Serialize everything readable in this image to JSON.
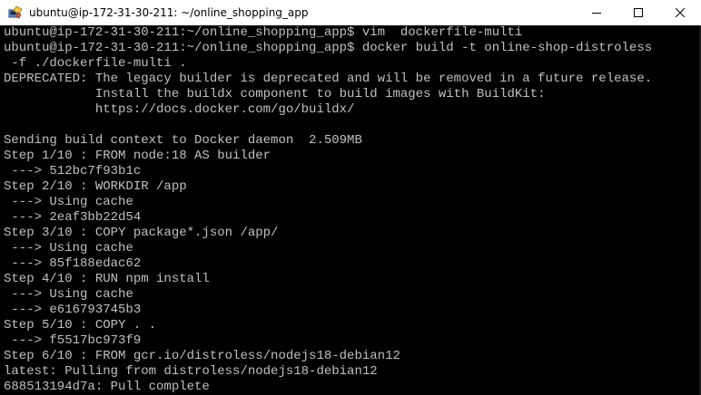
{
  "window": {
    "title": "ubuntu@ip-172-31-30-211: ~/online_shopping_app",
    "icon": "putty-icon",
    "controls": [
      "minimize-icon",
      "maximize-icon",
      "close-icon"
    ]
  },
  "terminal": {
    "text_color": "#c0c0c0",
    "background": "#000000",
    "lines": [
      "ubuntu@ip-172-31-30-211:~/online_shopping_app$ vim  dockerfile-multi",
      "ubuntu@ip-172-31-30-211:~/online_shopping_app$ docker build -t online-shop-distroless",
      " -f ./dockerfile-multi .",
      "DEPRECATED: The legacy builder is deprecated and will be removed in a future release.",
      "            Install the buildx component to build images with BuildKit:",
      "            https://docs.docker.com/go/buildx/",
      "",
      "Sending build context to Docker daemon  2.509MB",
      "Step 1/10 : FROM node:18 AS builder",
      " ---> 512bc7f93b1c",
      "Step 2/10 : WORKDIR /app",
      " ---> Using cache",
      " ---> 2eaf3bb22d54",
      "Step 3/10 : COPY package*.json /app/",
      " ---> Using cache",
      " ---> 85f188edac62",
      "Step 4/10 : RUN npm install",
      " ---> Using cache",
      " ---> e616793745b3",
      "Step 5/10 : COPY . .",
      " ---> f5517bc973f9",
      "Step 6/10 : FROM gcr.io/distroless/nodejs18-debian12",
      "latest: Pulling from distroless/nodejs18-debian12",
      "688513194d7a: Pull complete"
    ]
  }
}
